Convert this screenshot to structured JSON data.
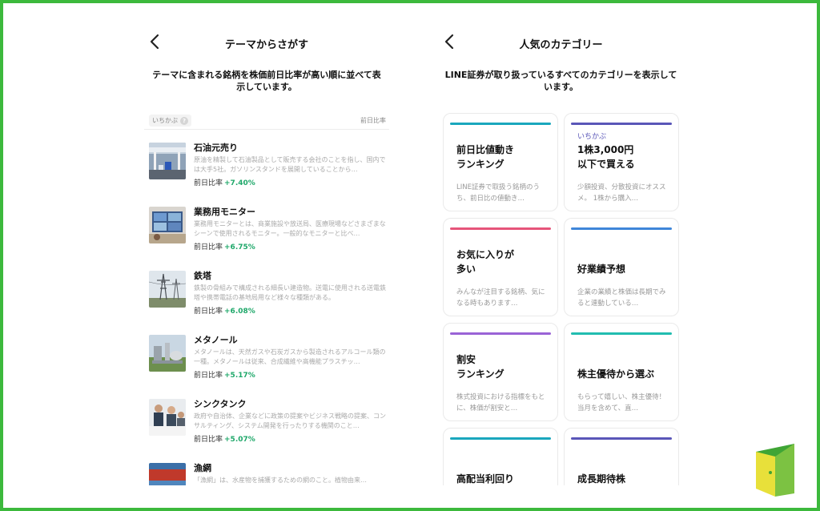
{
  "left": {
    "title": "テーマからさがす",
    "description": "テーマに含まれる銘柄を株価前日比率が高い順に並べて表示しています。",
    "filter_label": "いちかぶ",
    "filter_help": "?",
    "column_label": "前日比率",
    "rate_prefix": "前日比率",
    "items": [
      {
        "name": "石油元売り",
        "desc": "原油を精製して石油製品として販売する会社のことを指し、国内では大手5社。ガソリンスタンドを展開していることから…",
        "rate": "+7.40%",
        "icon": "gas-station-photo"
      },
      {
        "name": "業務用モニター",
        "desc": "業務用モニターとは、商業施設や放送局、医療現場などさまざまなシーンで使用されるモニター。一般的なモニターと比べ…",
        "rate": "+6.75%",
        "icon": "monitor-photo"
      },
      {
        "name": "鉄塔",
        "desc": "鉄製の骨組みで構成される細長い建造物。送電に使用される送電鉄塔や携帯電話の基地局用など様々な種類がある。",
        "rate": "+6.08%",
        "icon": "steel-tower-photo"
      },
      {
        "name": "メタノール",
        "desc": "メタノールは、天然ガスや石炭ガスから製造されるアルコール類の一種。メタノールは従来、合成繊維や高機能プラスチッ…",
        "rate": "+5.17%",
        "icon": "methanol-plant-photo"
      },
      {
        "name": "シンクタンク",
        "desc": "政府や自治体、企業などに政策の提案やビジネス戦略の提案、コンサルティング、システム開発を行ったりする機関のこと…",
        "rate": "+5.07%",
        "icon": "business-meeting-photo"
      },
      {
        "name": "漁網",
        "desc": "「漁網」は、水産物を捕獲するための網のこと。植物由来…",
        "rate": "",
        "icon": "fishing-net-photo"
      }
    ]
  },
  "right": {
    "title": "人気のカテゴリー",
    "description": "LINE証券が取り扱っているすべてのカテゴリーを表示しています。",
    "cards": [
      {
        "title": "前日比値動き\nランキング",
        "tag": "",
        "desc": "LINE証券で取扱う銘柄のうち、前日比の値動き…",
        "color": "#1aa7bd"
      },
      {
        "title": "1株3,000円\n以下で買える",
        "tag": "いちかぶ",
        "desc": "少額投資、分散投資にオススメ。 1株から購入…",
        "color": "#5a56b8"
      },
      {
        "title": "お気に入りが\n多い",
        "tag": "",
        "desc": "みんなが注目する銘柄、気になる時もあります…",
        "color": "#e6547a"
      },
      {
        "title": "好業績予想",
        "tag": "",
        "desc": "企業の業績と株価は長期でみると連動している…",
        "color": "#3f86d9"
      },
      {
        "title": "割安\nランキング",
        "tag": "",
        "desc": "株式投資における指標をもとに、株価が割安と…",
        "color": "#9a63d6"
      },
      {
        "title": "株主優待から選ぶ",
        "tag": "",
        "desc": "もらって嬉しい、株主優待！ 当月を含めて、直…",
        "color": "#22bdb0"
      },
      {
        "title": "高配当利回り",
        "tag": "",
        "desc": "",
        "color": "#1aa7bd"
      },
      {
        "title": "成長期待株",
        "tag": "",
        "desc": "",
        "color": "#5a56b8"
      }
    ]
  },
  "colors": {
    "frame": "#3cb93c",
    "positive": "#1fa86a",
    "logo_green": "#3fa535",
    "logo_yellow": "#e8e03a"
  }
}
